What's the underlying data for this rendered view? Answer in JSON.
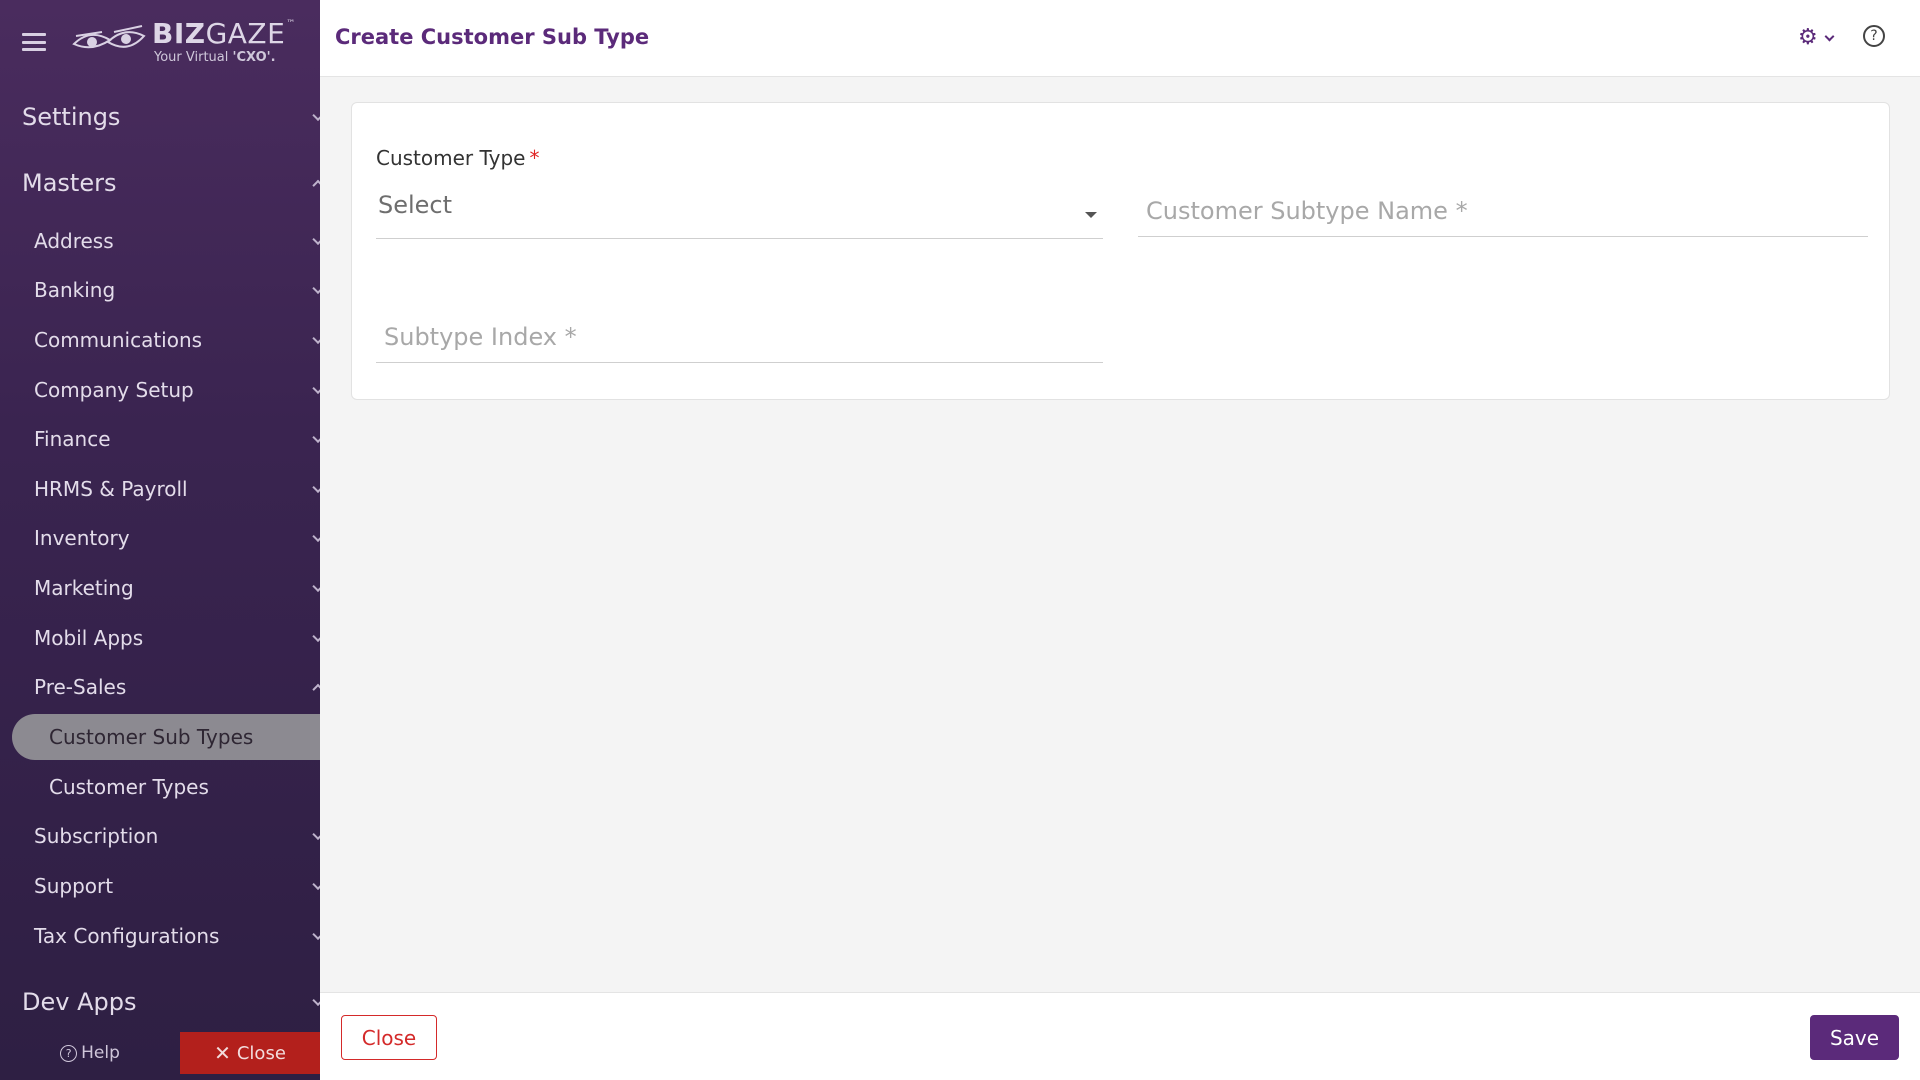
{
  "brand": {
    "name_bold": "BIZ",
    "name_light": "GAZE",
    "trademark": "™",
    "tagline_prefix": "Your Virtual",
    "tagline_bold": "'CXO'."
  },
  "sidebar": {
    "sections": [
      {
        "label": "Settings"
      },
      {
        "label": "Masters"
      }
    ],
    "items": [
      {
        "label": "Address"
      },
      {
        "label": "Banking"
      },
      {
        "label": "Communications"
      },
      {
        "label": "Company Setup"
      },
      {
        "label": "Finance"
      },
      {
        "label": "HRMS & Payroll"
      },
      {
        "label": "Inventory"
      },
      {
        "label": "Marketing"
      },
      {
        "label": "Mobil Apps"
      },
      {
        "label": "Pre-Sales"
      },
      {
        "label": "Subscription"
      },
      {
        "label": "Support"
      },
      {
        "label": "Tax Configurations"
      }
    ],
    "sub_items": [
      {
        "label": "Customer Sub Types",
        "active": true
      },
      {
        "label": "Customer Types",
        "active": false
      }
    ],
    "bottom_section": {
      "label": "Dev Apps"
    },
    "footer": {
      "help_label": "Help",
      "close_label": "Close"
    }
  },
  "header": {
    "title": "Create Customer Sub Type"
  },
  "form": {
    "customer_type": {
      "label": "Customer Type",
      "required_mark": "*",
      "value": "Select"
    },
    "subtype_name": {
      "placeholder": "Customer Subtype Name *"
    },
    "subtype_index": {
      "placeholder": "Subtype Index *"
    }
  },
  "footer": {
    "close_label": "Close",
    "save_label": "Save"
  },
  "colors": {
    "brand_purple": "#5b2a7a",
    "sidebar_bg": "#3a2450",
    "danger": "#d42a2a",
    "active_item_bg": "#8c8a91"
  }
}
